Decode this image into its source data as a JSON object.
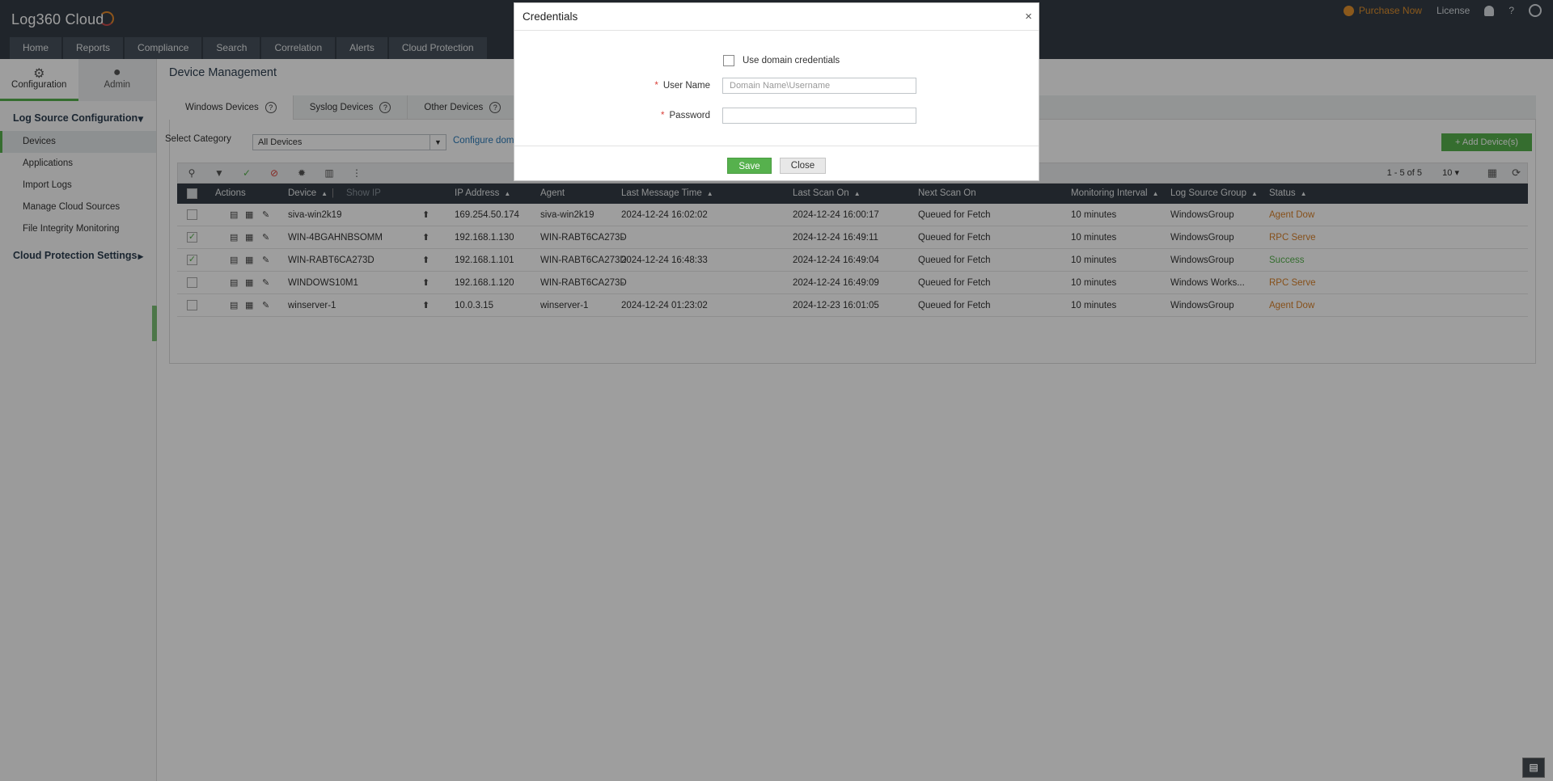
{
  "app": {
    "logo": "Log360 Cloud",
    "nav": [
      "Home",
      "Reports",
      "Compliance",
      "Search",
      "Correlation",
      "Alerts",
      "Cloud Protection"
    ],
    "links": {
      "purchase": "Purchase Now",
      "license": "License",
      "help": "?"
    }
  },
  "sidebar": {
    "tabs": [
      {
        "label": "Configuration",
        "icon": "gear-icon"
      },
      {
        "label": "Admin",
        "icon": "user-icon"
      }
    ],
    "section": "Log Source Configuration",
    "items": [
      "Devices",
      "Applications",
      "Import Logs",
      "Manage Cloud Sources",
      "File Integrity Monitoring"
    ],
    "section2": "Cloud Protection Settings"
  },
  "main": {
    "title": "Device Management",
    "tabs": [
      "Windows Devices",
      "Syslog Devices",
      "Other Devices"
    ],
    "category_label": "Select Category",
    "category_value": "All Devices",
    "configure_link": "Configure doma",
    "add_button": "Add Device(s)",
    "pager": "1 - 5 of 5",
    "per_page": "10"
  },
  "grid": {
    "columns": {
      "actions": "Actions",
      "device": "Device",
      "show_ip": "Show IP",
      "ip": "IP Address",
      "agent": "Agent",
      "last_message": "Last Message Time",
      "last_scan": "Last Scan On",
      "next_scan": "Next Scan On",
      "interval": "Monitoring Interval",
      "group": "Log Source Group",
      "status": "Status"
    },
    "rows": [
      {
        "checked": false,
        "device": "siva-win2k19",
        "ip": "169.254.50.174",
        "agent": "siva-win2k19",
        "last_message": "2024-12-24 16:02:02",
        "last_scan": "2024-12-24 16:00:17",
        "next_scan": "Queued for Fetch",
        "interval": "10 minutes",
        "group": "WindowsGroup",
        "status": "Agent Dow",
        "status_type": "warn"
      },
      {
        "checked": true,
        "device": "WIN-4BGAHNBSOMM",
        "ip": "192.168.1.130",
        "agent": "WIN-RABT6CA273D",
        "last_message": "-",
        "last_scan": "2024-12-24 16:49:11",
        "next_scan": "Queued for Fetch",
        "interval": "10 minutes",
        "group": "WindowsGroup",
        "status": "RPC Serve",
        "status_type": "warn"
      },
      {
        "checked": true,
        "device": "WIN-RABT6CA273D",
        "ip": "192.168.1.101",
        "agent": "WIN-RABT6CA273D",
        "last_message": "2024-12-24 16:48:33",
        "last_scan": "2024-12-24 16:49:04",
        "next_scan": "Queued for Fetch",
        "interval": "10 minutes",
        "group": "WindowsGroup",
        "status": "Success",
        "status_type": "ok"
      },
      {
        "checked": false,
        "device": "WINDOWS10M1",
        "ip": "192.168.1.120",
        "agent": "WIN-RABT6CA273D",
        "last_message": "-",
        "last_scan": "2024-12-24 16:49:09",
        "next_scan": "Queued for Fetch",
        "interval": "10 minutes",
        "group": "Windows Works...",
        "status": "RPC Serve",
        "status_type": "warn"
      },
      {
        "checked": false,
        "device": "winserver-1",
        "ip": "10.0.3.15",
        "agent": "winserver-1",
        "last_message": "2024-12-24 01:23:02",
        "last_scan": "2024-12-23 16:01:05",
        "next_scan": "Queued for Fetch",
        "interval": "10 minutes",
        "group": "WindowsGroup",
        "status": "Agent Dow",
        "status_type": "warn"
      }
    ]
  },
  "modal": {
    "title": "Credentials",
    "close_glyph": "×",
    "domain_checkbox": "Use domain credentials",
    "username_label": "User Name",
    "username_placeholder": "Domain Name\\Username",
    "password_label": "Password",
    "required_mark": "*",
    "save": "Save",
    "close": "Close"
  },
  "colors": {
    "accent": "#56b14d",
    "header": "#343d46",
    "warn": "#d9822b",
    "link": "#2a7ab8"
  }
}
